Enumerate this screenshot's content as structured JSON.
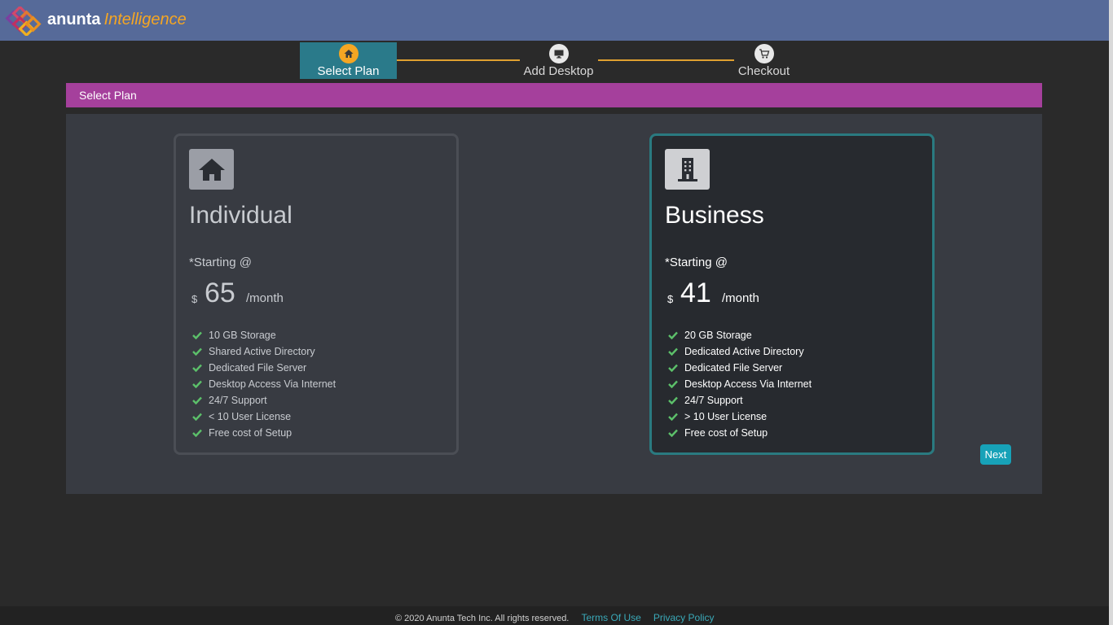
{
  "header": {
    "brand_name": "anunta",
    "brand_accent": "Intelligence",
    "logo_icon": "knot-logo-icon",
    "bg_color": "#566a99"
  },
  "stepper": {
    "steps": [
      {
        "label": "Select Plan",
        "icon": "home-icon",
        "state": "active"
      },
      {
        "label": "Add Desktop",
        "icon": "monitor-icon",
        "state": "inactive"
      },
      {
        "label": "Checkout",
        "icon": "cart-icon",
        "state": "inactive"
      }
    ],
    "active_color": "#2a7a8a",
    "connector_color": "#e0a030"
  },
  "section": {
    "title": "Select Plan",
    "color": "#a5409c"
  },
  "plans": [
    {
      "name": "Individual",
      "icon": "house-icon",
      "starting_label": "*Starting @",
      "currency": "$",
      "price": "65",
      "period": "/month",
      "features": [
        "10 GB Storage",
        "Shared Active Directory",
        "Dedicated File Server",
        "Desktop Access Via Internet",
        "24/7 Support",
        "< 10 User License",
        "Free cost of Setup"
      ]
    },
    {
      "name": "Business",
      "icon": "building-icon",
      "starting_label": "*Starting @",
      "currency": "$",
      "price": "41",
      "period": "/month",
      "selected": true,
      "features": [
        "20 GB Storage",
        "Dedicated Active Directory",
        "Dedicated File Server",
        "Desktop Access Via Internet",
        "24/7 Support",
        "> 10 User License",
        "Free cost of Setup"
      ]
    }
  ],
  "actions": {
    "next_label": "Next",
    "next_color": "#17a2b8"
  },
  "footer": {
    "copyright": "© 2020 Anunta Tech Inc. All rights reserved.",
    "terms_label": "Terms Of Use",
    "privacy_label": "Privacy Policy",
    "link_color": "#3aa9b8"
  }
}
